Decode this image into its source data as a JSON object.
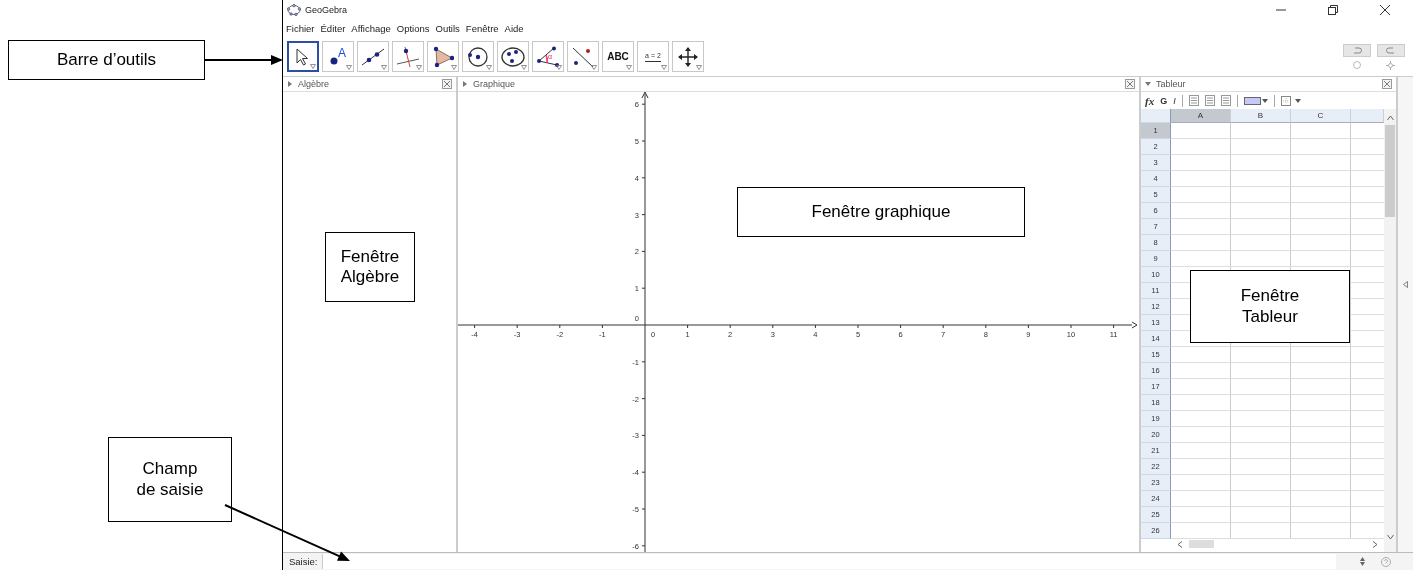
{
  "window": {
    "title": "GeoGebra"
  },
  "menu": [
    "Fichier",
    "Éditer",
    "Affichage",
    "Options",
    "Outils",
    "Fenêtre",
    "Aide"
  ],
  "tools": [
    {
      "kind": "move",
      "selected": true
    },
    {
      "kind": "point",
      "text": "A",
      "selected": false
    },
    {
      "kind": "line",
      "selected": false
    },
    {
      "kind": "perpendicular",
      "selected": false
    },
    {
      "kind": "polygon",
      "selected": false
    },
    {
      "kind": "circle",
      "selected": false
    },
    {
      "kind": "conic",
      "selected": false
    },
    {
      "kind": "angle",
      "text": "α",
      "selected": false
    },
    {
      "kind": "reflect",
      "selected": false
    },
    {
      "kind": "text",
      "text": "ABC",
      "selected": false
    },
    {
      "kind": "slider",
      "text": "a = 2",
      "selected": false
    },
    {
      "kind": "pan",
      "selected": false
    }
  ],
  "panels": {
    "algebra": {
      "title": "Algèbre",
      "style_bar_open": false
    },
    "graphics": {
      "title": "Graphique",
      "style_bar_open": false,
      "x_labels": [
        "-4",
        "-3",
        "-2",
        "-1",
        "0",
        "1",
        "2",
        "3",
        "4",
        "5",
        "6",
        "7",
        "8",
        "9",
        "10",
        "11"
      ],
      "y_labels": [
        "6",
        "5",
        "4",
        "3",
        "2",
        "1",
        "0",
        "-1",
        "-2",
        "-3",
        "-4",
        "-5",
        "-6"
      ]
    },
    "spreadsheet": {
      "title": "Tableur",
      "style_bar_open": true,
      "style_buttons": [
        "fx",
        "G",
        "I"
      ],
      "columns": [
        {
          "label": "A",
          "selected": true
        },
        {
          "label": "B",
          "selected": false
        },
        {
          "label": "C",
          "selected": false
        }
      ],
      "rows": [
        {
          "label": "1",
          "selected": true
        },
        {
          "label": "2",
          "selected": false
        },
        {
          "label": "3",
          "selected": false
        },
        {
          "label": "4",
          "selected": false
        },
        {
          "label": "5",
          "selected": false
        },
        {
          "label": "6",
          "selected": false
        },
        {
          "label": "7",
          "selected": false
        },
        {
          "label": "8",
          "selected": false
        },
        {
          "label": "9",
          "selected": false
        },
        {
          "label": "10",
          "selected": false
        },
        {
          "label": "11",
          "selected": false
        },
        {
          "label": "12",
          "selected": false
        },
        {
          "label": "13",
          "selected": false
        },
        {
          "label": "14",
          "selected": false
        },
        {
          "label": "15",
          "selected": false
        },
        {
          "label": "16",
          "selected": false
        },
        {
          "label": "17",
          "selected": false
        },
        {
          "label": "18",
          "selected": false
        },
        {
          "label": "19",
          "selected": false
        },
        {
          "label": "20",
          "selected": false
        },
        {
          "label": "21",
          "selected": false
        },
        {
          "label": "22",
          "selected": false
        },
        {
          "label": "23",
          "selected": false
        },
        {
          "label": "24",
          "selected": false
        },
        {
          "label": "25",
          "selected": false
        },
        {
          "label": "26",
          "selected": false
        }
      ]
    }
  },
  "input_bar": {
    "label": "Saisie:"
  },
  "annotations": [
    {
      "text": "Barre d’outils"
    },
    {
      "text": "Fenêtre Algèbre"
    },
    {
      "text": "Fenêtre graphique"
    },
    {
      "text": "Fenêtre Tableur"
    },
    {
      "text": "Champ de saisie"
    }
  ]
}
